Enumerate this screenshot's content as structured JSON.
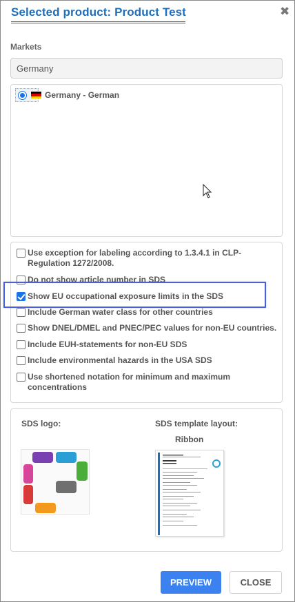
{
  "dialog": {
    "title": "Selected product: Product Test",
    "close_icon": "close-icon"
  },
  "markets": {
    "label": "Markets",
    "search_value": "Germany",
    "items": [
      {
        "label": "Germany - German",
        "selected": true,
        "flag": "germany-flag"
      }
    ]
  },
  "options": [
    {
      "label": "Use exception for labeling according to 1.3.4.1 in CLP-Regulation 1272/2008.",
      "checked": false
    },
    {
      "label": "Do not show article number in SDS",
      "checked": false
    },
    {
      "label": "Show EU occupational exposure limits in the SDS",
      "checked": true
    },
    {
      "label": "Include German water class for other countries",
      "checked": false
    },
    {
      "label": "Show DNEL/DMEL and PNEC/PEC values for non-EU countries.",
      "checked": false
    },
    {
      "label": "Include EUH-statements for non-EU SDS",
      "checked": false
    },
    {
      "label": "Include environmental hazards in the USA SDS",
      "checked": false
    },
    {
      "label": "Use shortened notation for minimum and maximum concentrations",
      "checked": false
    }
  ],
  "logo_section": {
    "sds_logo_label": "SDS logo:",
    "template_label": "SDS template layout:",
    "template_name": "Ribbon"
  },
  "footer": {
    "preview_label": "PREVIEW",
    "close_label": "CLOSE"
  },
  "colors": {
    "accent": "#1f6fb8",
    "primary_button": "#3b82f0",
    "highlight_border": "#4a60d8"
  }
}
